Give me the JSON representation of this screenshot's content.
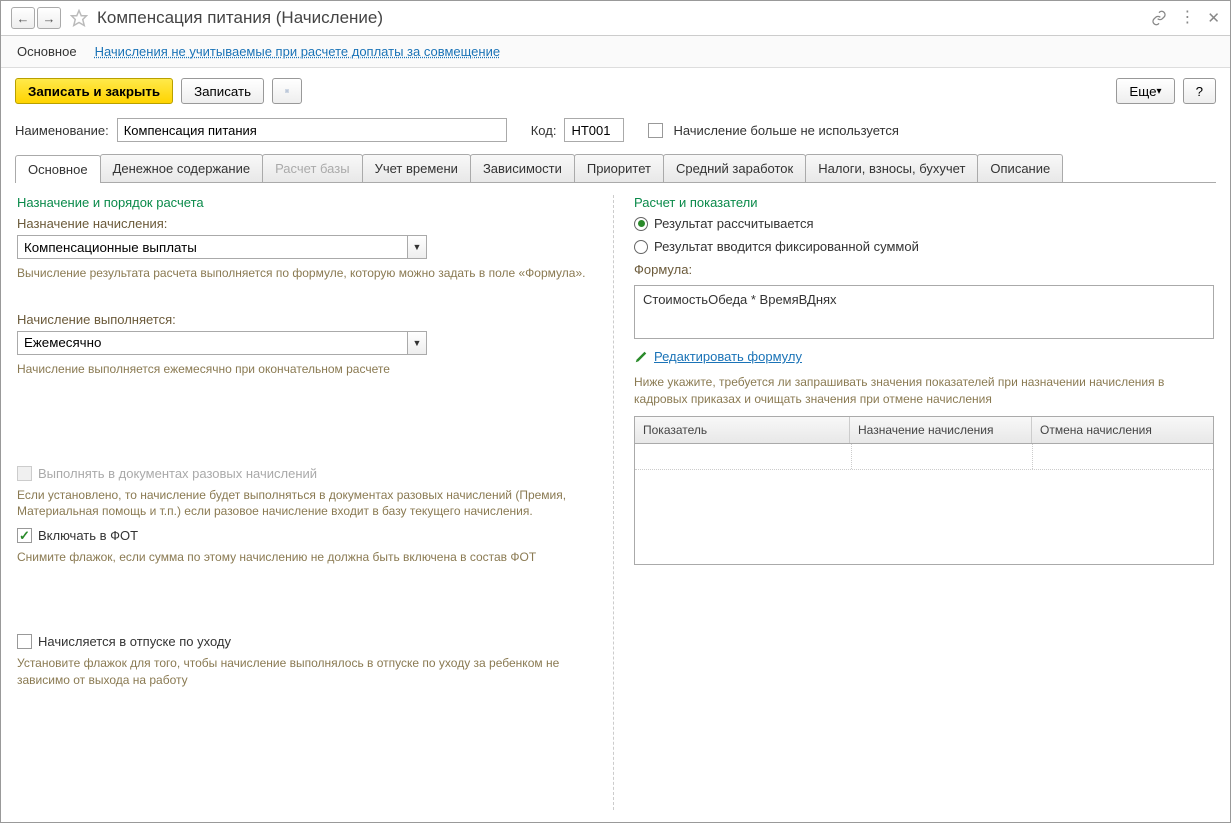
{
  "title": "Компенсация питания (Начисление)",
  "navTabs": {
    "main": "Основное",
    "link": "Начисления не учитываемые при расчете доплаты за совмещение"
  },
  "toolbar": {
    "saveClose": "Записать и закрыть",
    "save": "Записать",
    "more": "Еще",
    "help": "?"
  },
  "fields": {
    "nameLabel": "Наименование:",
    "nameValue": "Компенсация питания",
    "codeLabel": "Код:",
    "codeValue": "НТ001",
    "notUsedLabel": "Начисление больше не используется"
  },
  "tabs": [
    "Основное",
    "Денежное содержание",
    "Расчет базы",
    "Учет времени",
    "Зависимости",
    "Приоритет",
    "Средний заработок",
    "Налоги, взносы, бухучет",
    "Описание"
  ],
  "left": {
    "section": "Назначение и порядок расчета",
    "purposeLabel": "Назначение начисления:",
    "purposeValue": "Компенсационные выплаты",
    "purposeHint": "Вычисление результата расчета выполняется по формуле, которую можно задать в поле «Формула».",
    "performLabel": "Начисление выполняется:",
    "performValue": "Ежемесячно",
    "performHint": "Начисление выполняется ежемесячно при окончательном расчете",
    "oneoffLabel": "Выполнять в документах разовых начислений",
    "oneoffHint": "Если установлено, то начисление будет выполняться в документах разовых начислений (Премия, Материальная помощь и т.п.) если разовое начисление входит в базу текущего начисления.",
    "fotLabel": "Включать в ФОТ",
    "fotHint": "Снимите флажок, если сумма по этому начислению не должна быть включена в состав ФОТ",
    "vacationLabel": "Начисляется в отпуске по уходу",
    "vacationHint": "Установите флажок для того, чтобы начисление выполнялось в отпуске по уходу за ребенком не зависимо от выхода на работу"
  },
  "right": {
    "section": "Расчет и показатели",
    "radio1": "Результат рассчитывается",
    "radio2": "Результат вводится фиксированной суммой",
    "formulaLabel": "Формула:",
    "formulaValue": "СтоимостьОбеда *  ВремяВДнях",
    "editLink": "Редактировать формулу",
    "tableHint": "Ниже укажите, требуется ли запрашивать значения показателей при назначении начисления в кадровых приказах и очищать значения при отмене начисления",
    "th1": "Показатель",
    "th2": "Назначение начисления",
    "th3": "Отмена начисления"
  }
}
